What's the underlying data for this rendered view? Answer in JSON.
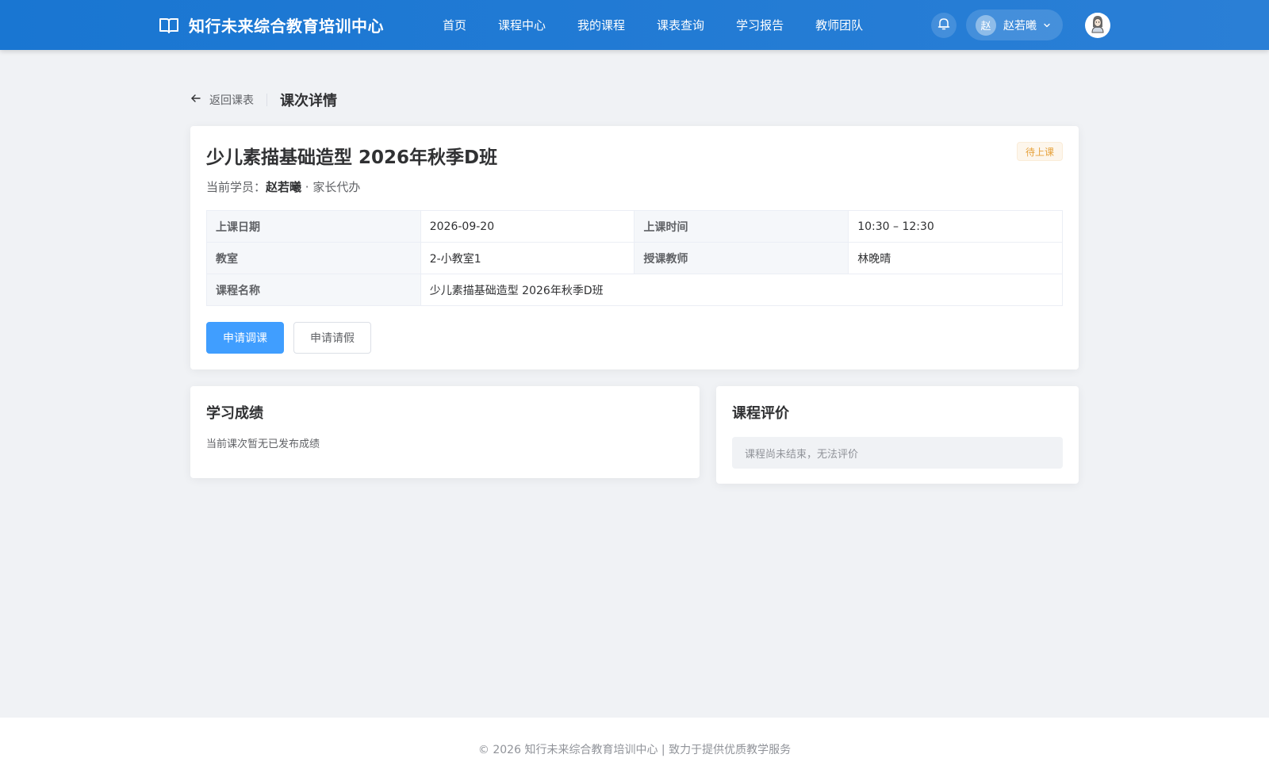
{
  "header": {
    "brand_title": "知行未来综合教育培训中心",
    "nav": [
      "首页",
      "课程中心",
      "我的课程",
      "课表查询",
      "学习报告",
      "教师团队"
    ],
    "user_avatar_char": "赵",
    "user_name": "赵若曦"
  },
  "breadcrumb": {
    "back_label": "返回课表",
    "page_title": "课次详情"
  },
  "detail": {
    "course_title": "少儿素描基础造型 2026年秋季D班",
    "status": "待上课",
    "student_prefix": "当前学员：",
    "student_name": "赵若曦",
    "student_suffix": " · 家长代办",
    "rows": [
      [
        {
          "label": "上课日期",
          "value": "2026-09-20"
        },
        {
          "label": "上课时间",
          "value": "10:30 – 12:30"
        }
      ],
      [
        {
          "label": "教室",
          "value": "2-小教室1"
        },
        {
          "label": "授课教师",
          "value": "林晚晴"
        }
      ]
    ],
    "course_name_label": "课程名称",
    "course_name_value": "少儿素描基础造型 2026年秋季D班",
    "btn_reschedule": "申请调课",
    "btn_leave": "申请请假"
  },
  "score": {
    "title": "学习成绩",
    "empty_text": "当前课次暂无已发布成绩"
  },
  "evaluation": {
    "title": "课程评价",
    "notice": "课程尚未结束，无法评价"
  },
  "footer": {
    "text": "© 2026 知行未来综合教育培训中心 | 致力于提供优质教学服务"
  },
  "colors": {
    "header_bg": "#1976d2",
    "primary": "#409eff",
    "status_warning": "#e6a23c",
    "page_bg": "#f0f2f5"
  },
  "icons": [
    "book-icon",
    "bell-icon",
    "chevron-down-icon",
    "avatar-icon",
    "arrow-left-icon"
  ]
}
